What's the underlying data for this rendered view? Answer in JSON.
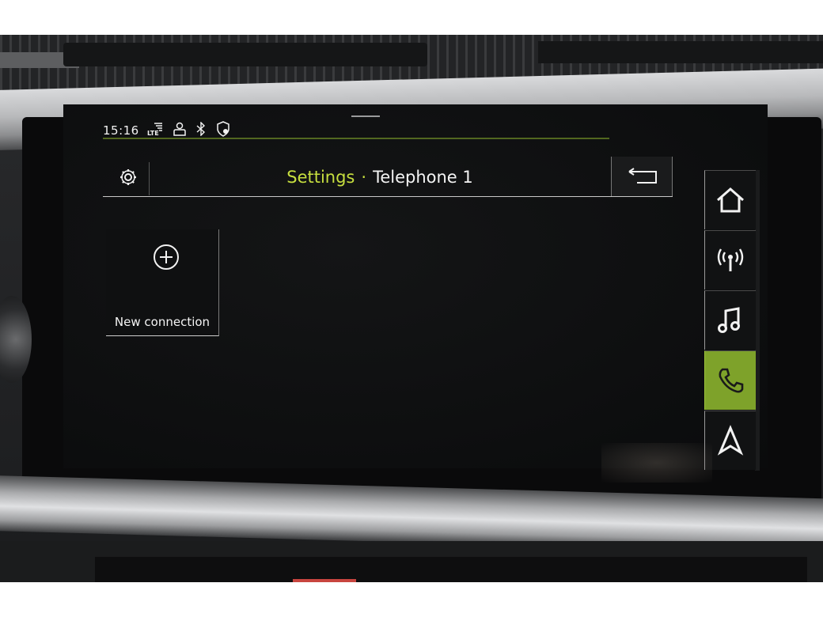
{
  "status_bar": {
    "time": "15:16",
    "icons": [
      "lte-signal-icon",
      "user-profile-icon",
      "bluetooth-icon",
      "location-shield-icon"
    ],
    "network_label": "LTE"
  },
  "header": {
    "breadcrumb_parent": "Settings",
    "breadcrumb_separator": "·",
    "title": "Telephone 1",
    "settings_icon": "gear-icon",
    "back_icon": "back-arrow-icon"
  },
  "tiles": [
    {
      "label": "New connection",
      "icon": "plus-circle-icon"
    }
  ],
  "rail": {
    "items": [
      {
        "icon": "home-icon",
        "active": false
      },
      {
        "icon": "radio-icon",
        "active": false
      },
      {
        "icon": "music-note-icon",
        "active": false
      },
      {
        "icon": "phone-icon",
        "active": true
      },
      {
        "icon": "navigation-icon",
        "active": false
      }
    ]
  },
  "colors": {
    "accent": "#7ea22a",
    "accent_text": "#c7df3f",
    "text": "#f4f4f4",
    "screen_bg": "#0d0e0f"
  }
}
